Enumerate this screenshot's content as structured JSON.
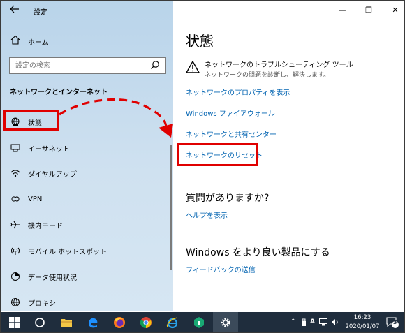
{
  "window": {
    "title": "設定",
    "controls": {
      "minimize": "—",
      "maximize": "❐",
      "close": "✕"
    }
  },
  "nav": {
    "back_icon": "back-arrow-icon",
    "home": {
      "label": "ホーム",
      "icon": "home-icon"
    },
    "search": {
      "placeholder": "設定の検索",
      "icon": "search-icon"
    },
    "section_title": "ネットワークとインターネット",
    "items": [
      {
        "label": "状態",
        "icon": "globe-status-icon",
        "selected": true
      },
      {
        "label": "イーサネット",
        "icon": "ethernet-icon"
      },
      {
        "label": "ダイヤルアップ",
        "icon": "dialup-icon"
      },
      {
        "label": "VPN",
        "icon": "vpn-icon"
      },
      {
        "label": "機内モード",
        "icon": "airplane-icon"
      },
      {
        "label": "モバイル ホットスポット",
        "icon": "hotspot-icon"
      },
      {
        "label": "データ使用状況",
        "icon": "data-usage-icon"
      },
      {
        "label": "プロキシ",
        "icon": "globe-icon"
      }
    ]
  },
  "content": {
    "title": "状態",
    "troubleshoot": {
      "title": "ネットワークのトラブルシューティング ツール",
      "subtitle": "ネットワークの問題を診断し、解決します。",
      "icon": "warning-icon"
    },
    "links": [
      "ネットワークのプロパティを表示",
      "Windows ファイアウォール",
      "ネットワークと共有センター",
      "ネットワークのリセット"
    ],
    "question_title": "質問がありますか?",
    "help_link": "ヘルプを表示",
    "better_title": "Windows をより良い製品にする",
    "feedback_link": "フィードバックの送信"
  },
  "annotation": {
    "color": "#e00000"
  },
  "taskbar": {
    "clock_time": "16:23",
    "clock_date": "2020/01/07",
    "notification_count": "3",
    "ime_label": "A"
  },
  "colors": {
    "accent": "#0063b1",
    "nav_bg": "#c3dbee",
    "taskbar": "#1f2d3d"
  }
}
